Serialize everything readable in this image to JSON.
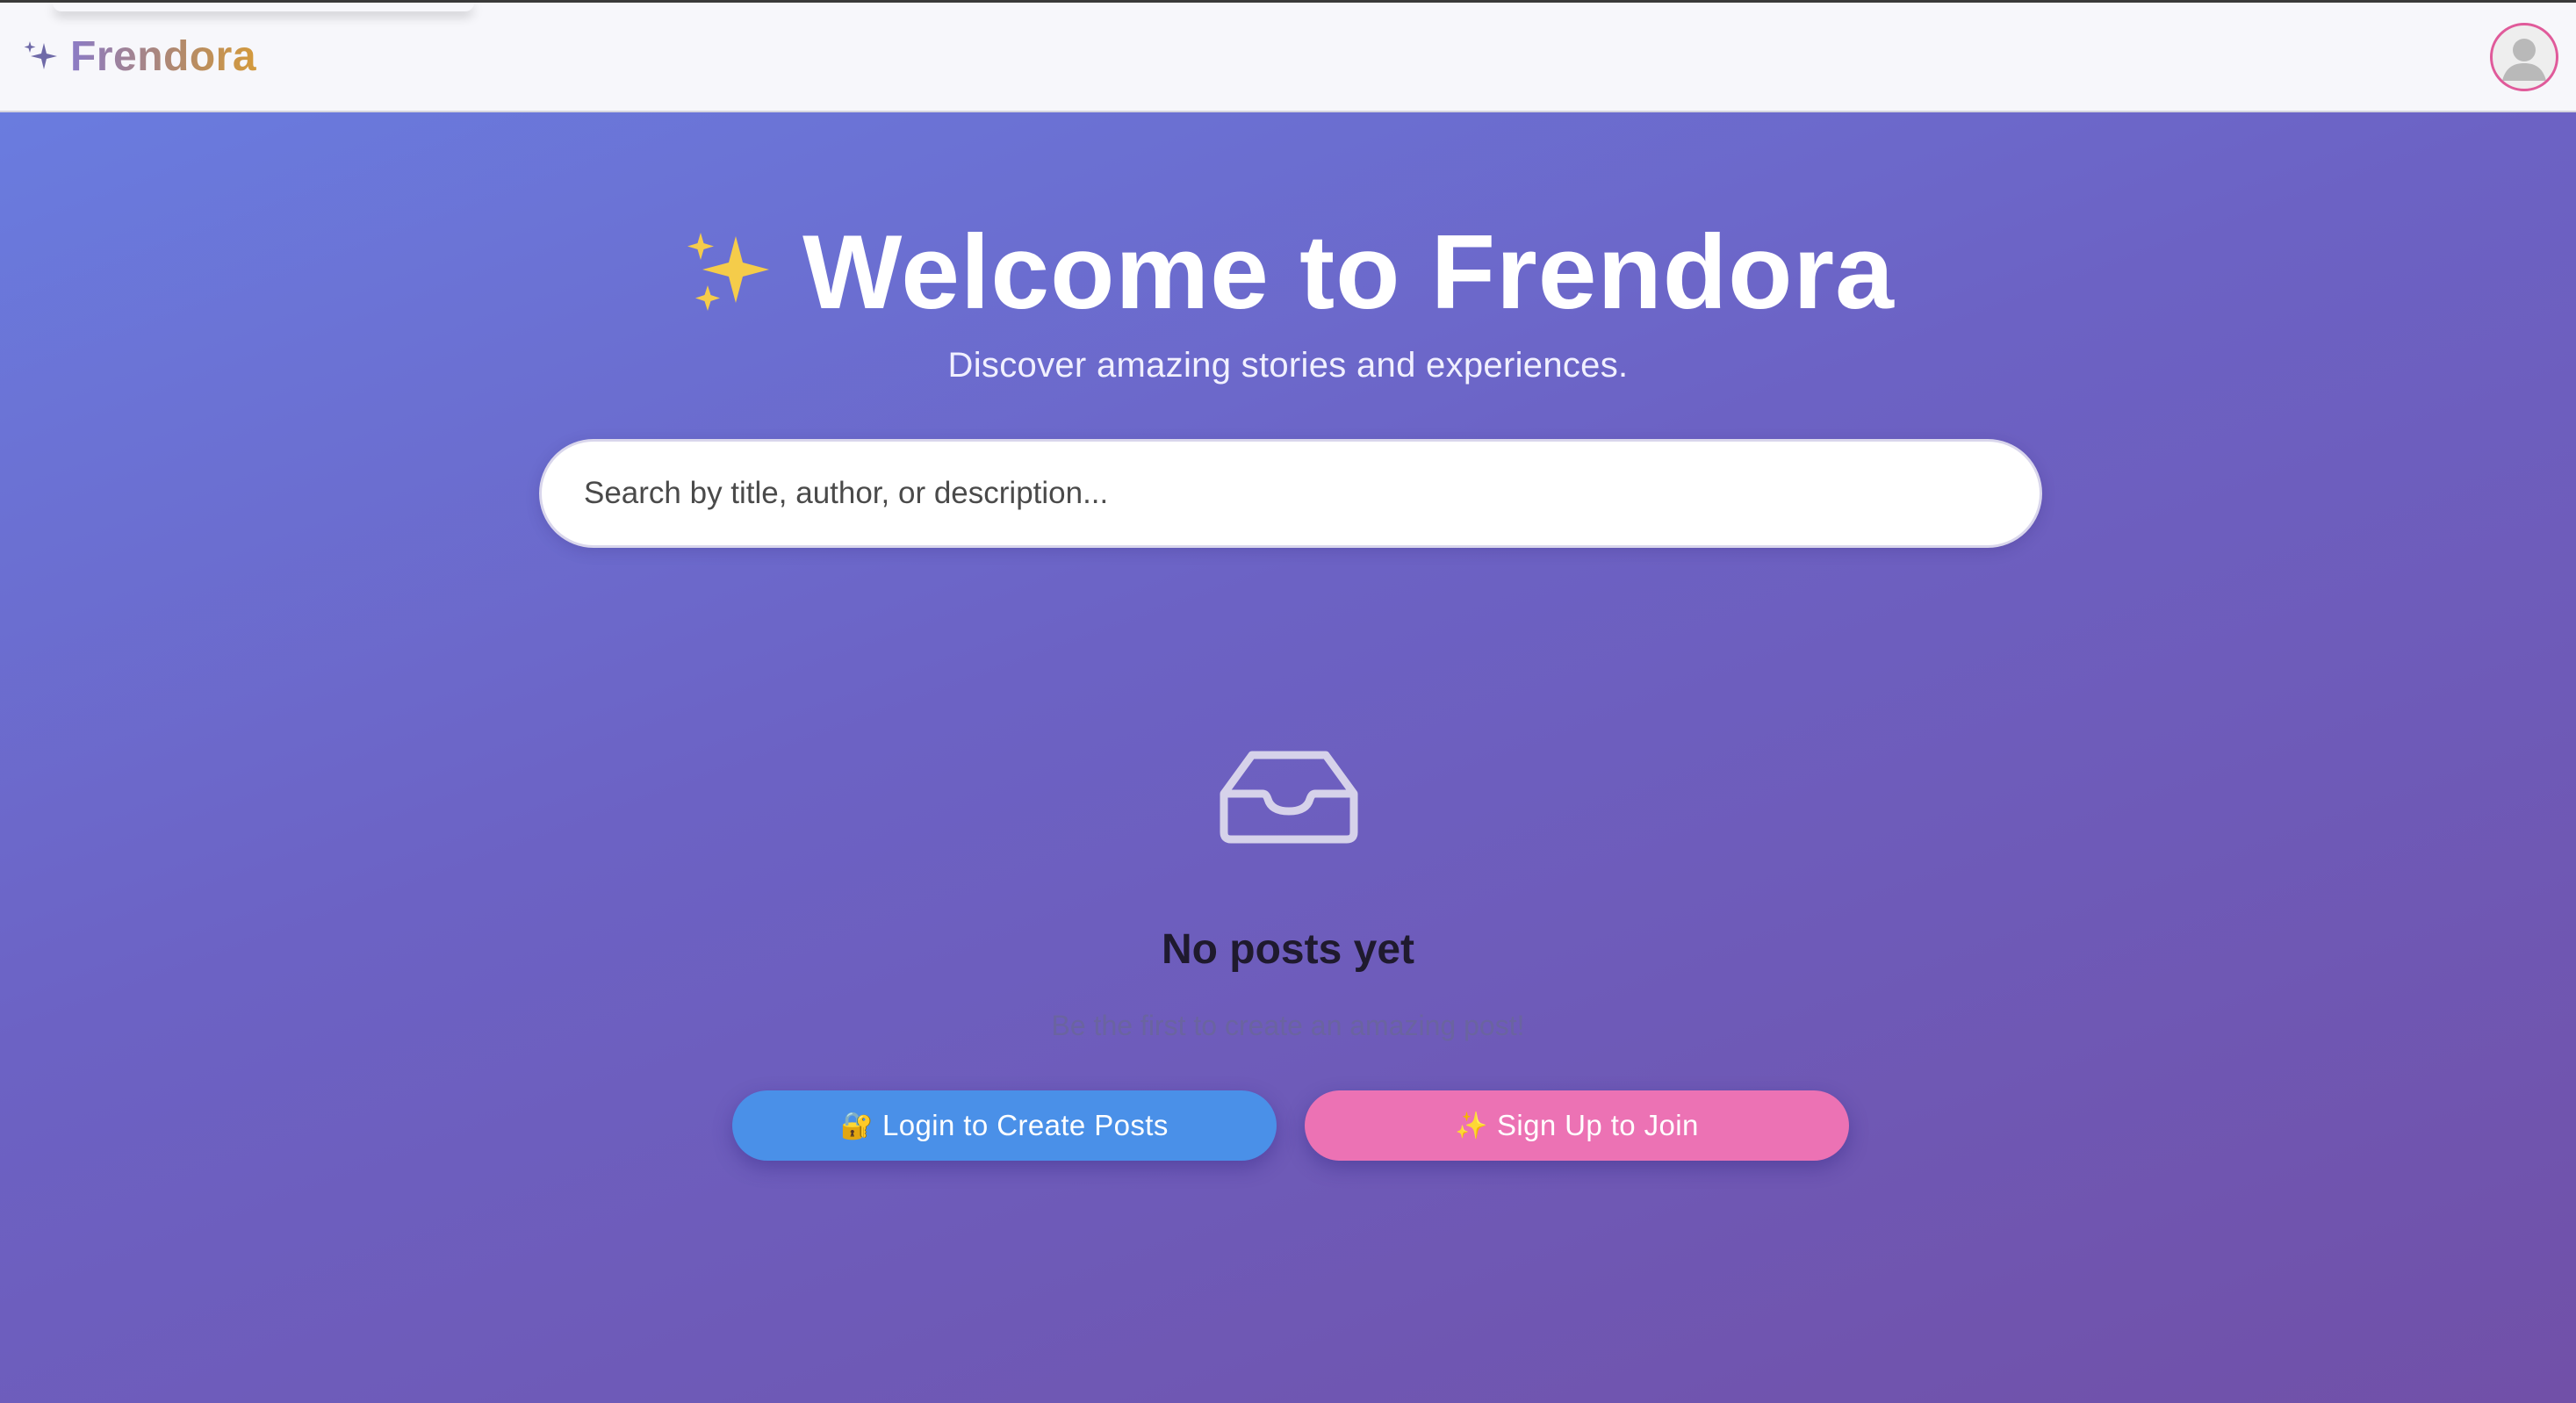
{
  "app": {
    "name": "Frendora",
    "brand_icon": "sparkles-icon",
    "colors": {
      "gradient_start": "#6a7fe2",
      "gradient_end": "#7150a8",
      "login_button": "#4a90e8",
      "signup_button": "#ec72b4",
      "avatar_border": "#e05a9a"
    }
  },
  "header": {
    "avatar_icon": "user-avatar-icon"
  },
  "hero": {
    "emoji": "✨",
    "title": "Welcome to Frendora",
    "subtitle": "Discover amazing stories and experiences."
  },
  "search": {
    "placeholder": "Search by title, author, or description...",
    "value": ""
  },
  "empty_state": {
    "icon": "inbox-icon",
    "title": "No posts yet",
    "subtitle": "Be the first to create an amazing post!"
  },
  "actions": {
    "login_emoji": "🔐",
    "login_label": "Login to Create Posts",
    "signup_emoji": "✨",
    "signup_label": "Sign Up to Join"
  }
}
